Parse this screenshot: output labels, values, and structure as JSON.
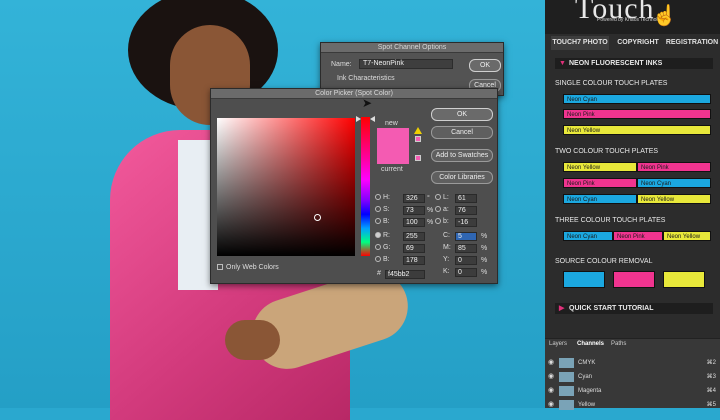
{
  "spot_dialog": {
    "title": "Spot Channel Options",
    "name_label": "Name:",
    "name_value": "T7-NeonPink",
    "ink_label": "Ink Characteristics",
    "ok": "OK",
    "cancel": "Cancel"
  },
  "picker": {
    "title": "Color Picker (Spot Color)",
    "ok": "OK",
    "cancel": "Cancel",
    "add_swatches": "Add to Swatches",
    "color_libraries": "Color Libraries",
    "new_label": "new",
    "current_label": "current",
    "only_web": "Only Web Colors",
    "hex": "f45bb2",
    "hex_label": "#",
    "hsb": [
      {
        "label": "H:",
        "value": "326",
        "unit": "°"
      },
      {
        "label": "S:",
        "value": "73",
        "unit": "%"
      },
      {
        "label": "B:",
        "value": "100",
        "unit": "%"
      }
    ],
    "rgb": [
      {
        "label": "R:",
        "value": "255"
      },
      {
        "label": "G:",
        "value": "69"
      },
      {
        "label": "B:",
        "value": "178"
      }
    ],
    "lab": [
      {
        "label": "L:",
        "value": "61"
      },
      {
        "label": "a:",
        "value": "76"
      },
      {
        "label": "b:",
        "value": "-16"
      }
    ],
    "cmyk": [
      {
        "label": "C:",
        "value": "5",
        "unit": "%"
      },
      {
        "label": "M:",
        "value": "85",
        "unit": "%"
      },
      {
        "label": "Y:",
        "value": "0",
        "unit": "%"
      },
      {
        "label": "K:",
        "value": "0",
        "unit": "%"
      }
    ]
  },
  "panel": {
    "logo": "Touch",
    "powered": "Powered by Khaos Technology",
    "tabs": [
      "TOUCH7 PHOTO",
      "COPYRIGHT",
      "REGISTRATION"
    ],
    "section1": "NEON FLUORESCENT INKS",
    "single_title": "SINGLE COLOUR TOUCH PLATES",
    "single": [
      "Neon Cyan",
      "Neon Pink",
      "Neon Yellow"
    ],
    "two_title": "TWO COLOUR TOUCH PLATES",
    "two": [
      [
        "Neon Yellow",
        "Neon Pink"
      ],
      [
        "Neon Pink",
        "Neon Cyan"
      ],
      [
        "Neon Cyan",
        "Neon Yellow"
      ]
    ],
    "three_title": "THREE COLOUR TOUCH PLATES",
    "three": [
      "Neon Cyan",
      "Neon Pink",
      "Neon Yellow"
    ],
    "removal_title": "SOURCE COLOUR REMOVAL",
    "section2": "QUICK START TUTORIAL"
  },
  "layers": {
    "tabs": [
      "Layers",
      "Channels",
      "Paths"
    ],
    "rows": [
      {
        "name": "CMYK",
        "shortcut": "⌘2"
      },
      {
        "name": "Cyan",
        "shortcut": "⌘3"
      },
      {
        "name": "Magenta",
        "shortcut": "⌘4"
      },
      {
        "name": "Yellow",
        "shortcut": "⌘5"
      }
    ]
  }
}
